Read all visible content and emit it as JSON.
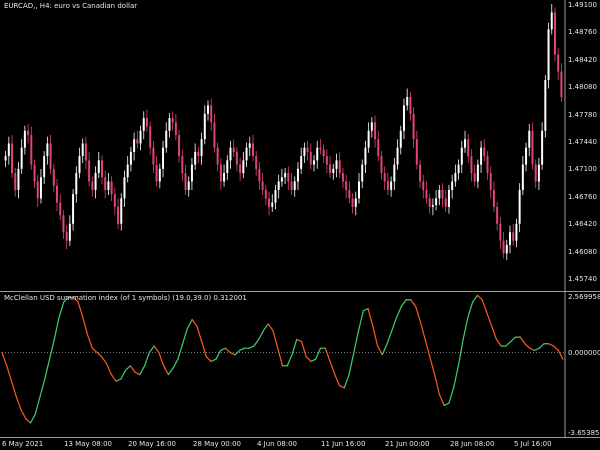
{
  "price_panel": {
    "title": "EURCAD,, H4:  euro vs Canadian dollar",
    "y_ticks": [
      "1.49100",
      "1.48760",
      "1.48420",
      "1.48080",
      "1.47780",
      "1.47440",
      "1.47100",
      "1.46760",
      "1.46420",
      "1.46080",
      "1.45740"
    ]
  },
  "indicator_panel": {
    "title": "McClellan USD summation index (of 1 symbols) (19.0,39.0) 0.312001",
    "y_ticks": [
      "2.569958",
      "0.000000",
      "-3.653852"
    ]
  },
  "x_ticks": [
    "6 May 2021",
    "13 May 08:00",
    "20 May 16:00",
    "28 May 00:00",
    "4 Jun 08:00",
    "11 Jun 16:00",
    "21 Jun 00:00",
    "28 Jun 08:00",
    "5 Jul 16:00"
  ],
  "colors": {
    "background": "#000000",
    "bull_candle": "#ffffff",
    "bear_candle": "#e0457a",
    "osc_rising": "#3cd070",
    "osc_falling": "#ff5a1f",
    "zero_line": "#888888"
  },
  "chart_data": [
    {
      "type": "candlestick",
      "title": "EURCAD,, H4:  euro vs Canadian dollar",
      "ylim": [
        1.4574,
        1.491
      ],
      "close": [
        1.473,
        1.4745,
        1.471,
        1.469,
        1.4715,
        1.474,
        1.476,
        1.4755,
        1.472,
        1.47,
        1.468,
        1.4705,
        1.473,
        1.4745,
        1.4715,
        1.4695,
        1.4675,
        1.466,
        1.464,
        1.463,
        1.465,
        1.4685,
        1.471,
        1.473,
        1.4745,
        1.4725,
        1.47,
        1.469,
        1.471,
        1.4725,
        1.4705,
        1.469,
        1.47,
        1.4685,
        1.467,
        1.465,
        1.468,
        1.4705,
        1.472,
        1.4735,
        1.475,
        1.4745,
        1.476,
        1.4775,
        1.4765,
        1.474,
        1.472,
        1.47,
        1.4715,
        1.474,
        1.476,
        1.4775,
        1.477,
        1.4755,
        1.473,
        1.471,
        1.469,
        1.47,
        1.472,
        1.4735,
        1.473,
        1.475,
        1.478,
        1.479,
        1.477,
        1.474,
        1.472,
        1.47,
        1.471,
        1.4725,
        1.474,
        1.4735,
        1.472,
        1.471,
        1.4725,
        1.474,
        1.4745,
        1.473,
        1.4715,
        1.47,
        1.469,
        1.468,
        1.467,
        1.4675,
        1.469,
        1.47,
        1.4705,
        1.471,
        1.47,
        1.469,
        1.47,
        1.4715,
        1.473,
        1.474,
        1.4735,
        1.472,
        1.4725,
        1.474,
        1.4738,
        1.473,
        1.472,
        1.471,
        1.4715,
        1.4725,
        1.471,
        1.47,
        1.469,
        1.468,
        1.467,
        1.468,
        1.47,
        1.472,
        1.474,
        1.476,
        1.477,
        1.475,
        1.473,
        1.471,
        1.47,
        1.469,
        1.47,
        1.472,
        1.474,
        1.476,
        1.479,
        1.48,
        1.478,
        1.475,
        1.472,
        1.47,
        1.469,
        1.468,
        1.467,
        1.4672,
        1.468,
        1.469,
        1.468,
        1.467,
        1.469,
        1.47,
        1.471,
        1.472,
        1.474,
        1.475,
        1.473,
        1.471,
        1.47,
        1.472,
        1.474,
        1.473,
        1.471,
        1.469,
        1.467,
        1.465,
        1.463,
        1.4615,
        1.4625,
        1.464,
        1.463,
        1.465,
        1.469,
        1.472,
        1.474,
        1.476,
        1.472,
        1.47,
        1.472,
        1.476,
        1.482,
        1.488,
        1.49,
        1.485,
        1.483,
        1.48
      ]
    },
    {
      "type": "line",
      "title": "McClellan USD summation index (of 1 symbols) (19.0,39.0) 0.312001",
      "ylim": [
        -3.653852,
        2.569958
      ],
      "values": [
        0.0,
        -0.6,
        -1.3,
        -2.0,
        -2.6,
        -3.0,
        -3.2,
        -2.8,
        -2.0,
        -1.2,
        -0.3,
        0.6,
        1.6,
        2.3,
        2.5,
        2.5,
        2.3,
        1.6,
        0.8,
        0.2,
        0.0,
        -0.2,
        -0.5,
        -1.0,
        -1.3,
        -1.2,
        -0.8,
        -0.6,
        -0.9,
        -1.0,
        -0.6,
        0.0,
        0.3,
        0.0,
        -0.6,
        -1.0,
        -0.7,
        -0.3,
        0.4,
        1.1,
        1.5,
        1.2,
        0.5,
        -0.2,
        -0.4,
        -0.3,
        0.1,
        0.2,
        0.0,
        -0.1,
        0.1,
        0.2,
        0.2,
        0.3,
        0.6,
        1.0,
        1.3,
        1.0,
        0.2,
        -0.6,
        -0.6,
        -0.1,
        0.6,
        0.5,
        -0.2,
        -0.4,
        -0.3,
        0.2,
        0.2,
        -0.4,
        -1.0,
        -1.5,
        -1.6,
        -1.0,
        0.0,
        1.0,
        1.9,
        2.0,
        1.2,
        0.3,
        -0.1,
        0.4,
        1.0,
        1.6,
        2.1,
        2.4,
        2.4,
        2.1,
        1.4,
        0.6,
        -0.2,
        -1.0,
        -1.9,
        -2.4,
        -2.3,
        -1.6,
        -0.6,
        0.6,
        1.6,
        2.3,
        2.6,
        2.4,
        1.8,
        1.2,
        0.6,
        0.3,
        0.3,
        0.5,
        0.7,
        0.7,
        0.4,
        0.2,
        0.1,
        0.2,
        0.4,
        0.4,
        0.3,
        0.1,
        -0.3
      ]
    }
  ]
}
